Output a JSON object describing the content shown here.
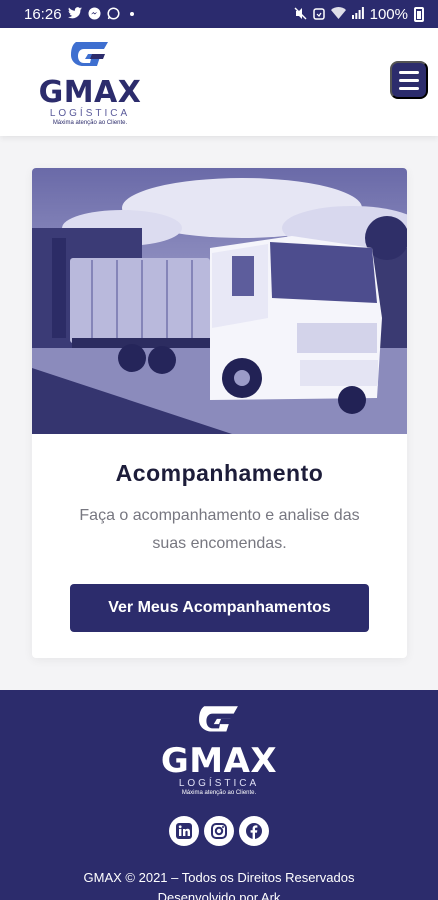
{
  "status_bar": {
    "time": "16:26",
    "battery": "100%",
    "icons": [
      "twitter-icon",
      "messenger-icon",
      "whatsapp-icon",
      "mute-icon",
      "alarm-icon",
      "wifi-icon",
      "signal-icon",
      "battery-icon"
    ]
  },
  "header": {
    "logo": {
      "wordmark": "GMAX",
      "sub": "LOGÍSTICA",
      "tagline": "Máxima atenção ao Cliente."
    },
    "menu_icon": "hamburger-menu-icon"
  },
  "card": {
    "image_alt": "truck photo",
    "title": "Acompanhamento",
    "text": "Faça o acompanhamento e analise das suas encomendas.",
    "button_label": "Ver Meus Acompanhamentos"
  },
  "footer": {
    "logo": {
      "wordmark": "GMAX",
      "sub": "LOGÍSTICA",
      "tagline": "Máxima atenção ao Cliente."
    },
    "socials": [
      {
        "name": "linkedin",
        "icon": "linkedin-icon",
        "glyph": "in"
      },
      {
        "name": "instagram",
        "icon": "instagram-icon",
        "glyph": "◎"
      },
      {
        "name": "facebook",
        "icon": "facebook-icon",
        "glyph": "f"
      }
    ],
    "copyright": "GMAX © 2021 – Todos os Direitos Reservados",
    "credits": "Desenvolvido por Ark"
  },
  "colors": {
    "brand": "#2c2c6c",
    "status_bar": "#2b2b6e",
    "background": "#f4f4f6"
  }
}
